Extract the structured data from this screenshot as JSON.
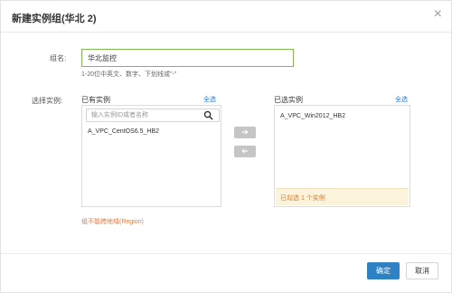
{
  "dialog": {
    "title": "新建实例组(华北 2)",
    "close_icon": "close-icon"
  },
  "form": {
    "name_label": "组名:",
    "name_value": "华北监控",
    "name_hint": "1-20位中英文、数字、下划线或\"-\"",
    "select_label": "选择实例:"
  },
  "available": {
    "header": "已有实例",
    "select_all": "全选",
    "search_placeholder": "输入实例ID或者名称",
    "search_icon": "search-icon",
    "items": [
      "A_VPC_CentOS6.5_HB2"
    ]
  },
  "transfer": {
    "add_icon": "arrow-right-icon",
    "remove_icon": "arrow-left-icon"
  },
  "selected": {
    "header": "已选实例",
    "select_all": "全选",
    "items": [
      "A_VPC_Win2012_HB2"
    ],
    "summary_prefix": "已勾选",
    "summary_count": "1",
    "summary_suffix": "个实例"
  },
  "region_note": "组不能跨地域(Region)",
  "footer": {
    "ok_label": "确定",
    "cancel_label": "取消"
  },
  "colors": {
    "accent": "#2e82c4",
    "input_focus": "#7dbb53",
    "warning_text": "#e07a1a",
    "warning_bg": "#fcf3dc"
  }
}
